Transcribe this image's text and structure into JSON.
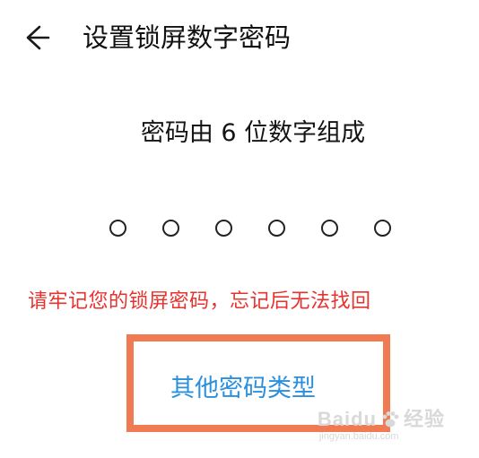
{
  "header": {
    "title": "设置锁屏数字密码",
    "back_icon": "arrow-left-icon"
  },
  "prompt": {
    "subtitle": "密码由 6 位数字组成"
  },
  "pin": {
    "length": 6,
    "filled": 0
  },
  "warning": {
    "text": "请牢记您的锁屏密码，忘记后无法找回",
    "color": "#e8322e"
  },
  "actions": {
    "other_types_label": "其他密码类型",
    "link_color": "#2a8fdc",
    "highlight_color": "#f07a52"
  },
  "watermark": {
    "brand": "Baidu",
    "suffix": "经验",
    "url": "jingyan.baidu.com"
  }
}
